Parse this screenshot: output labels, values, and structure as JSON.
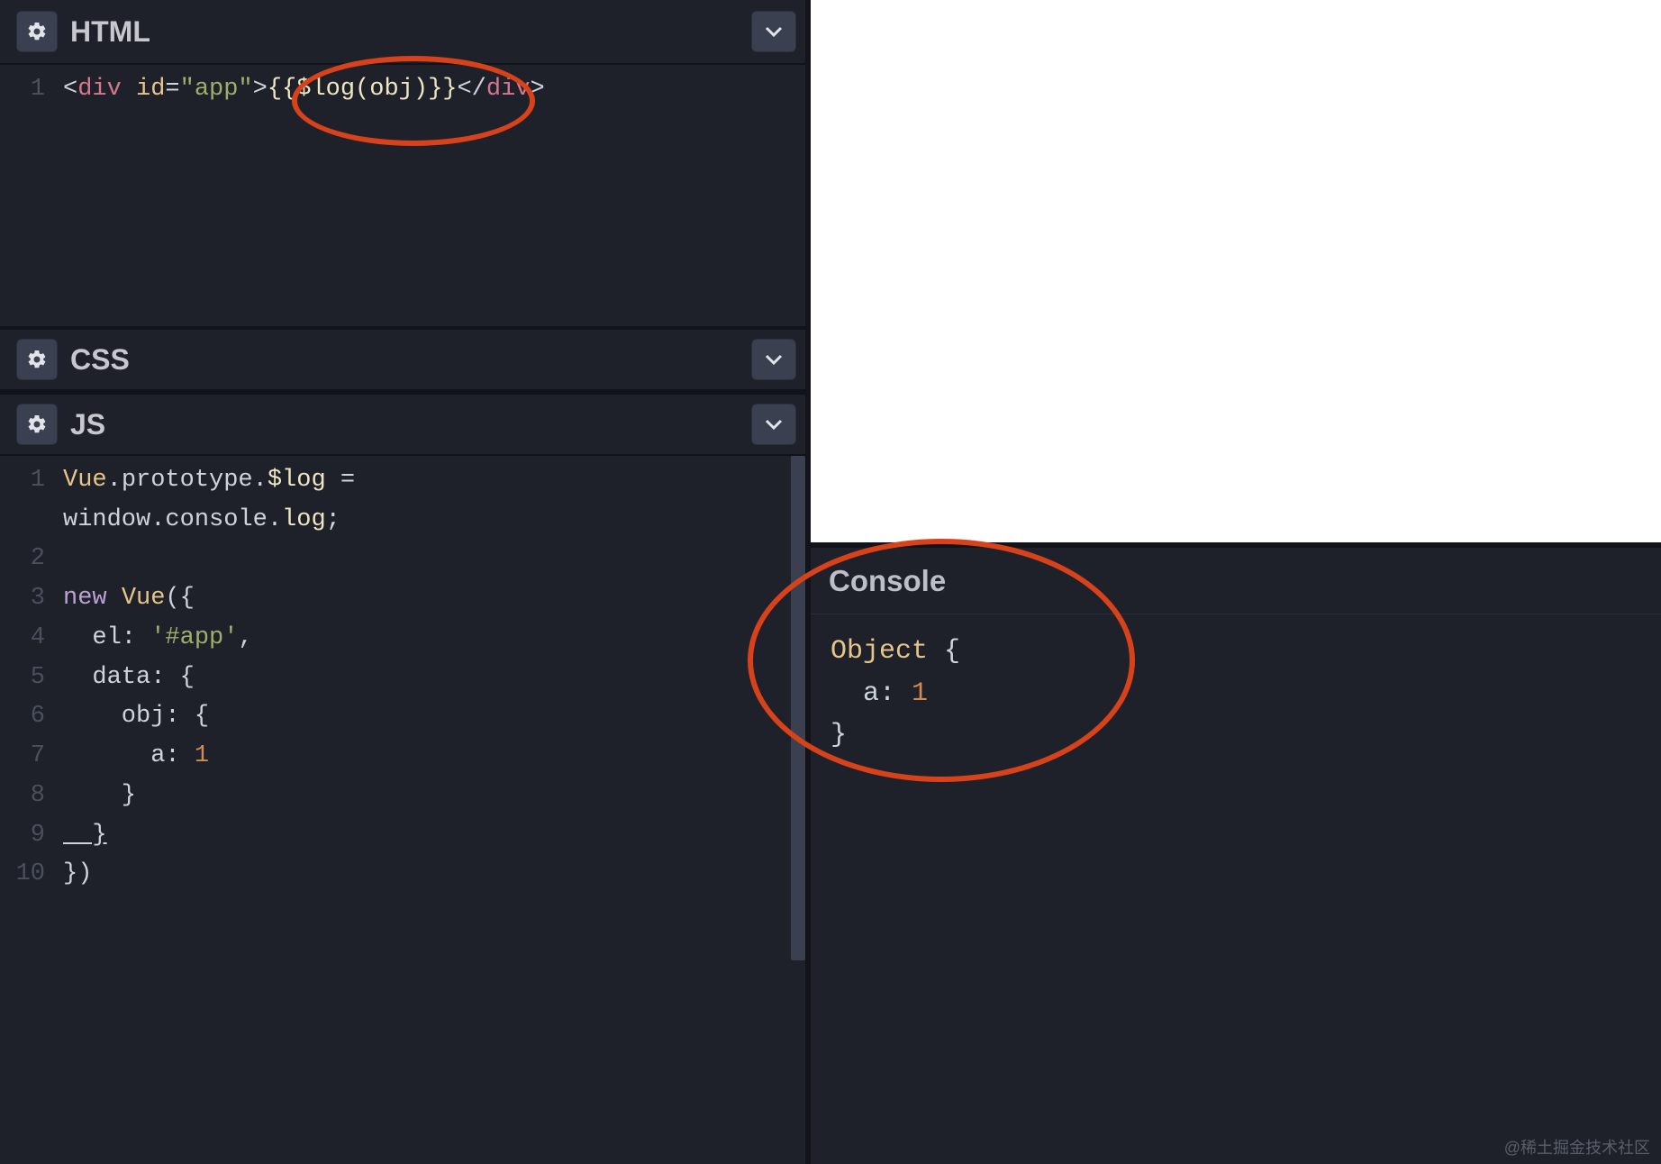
{
  "panels": {
    "html": {
      "title": "HTML"
    },
    "css": {
      "title": "CSS"
    },
    "js": {
      "title": "JS"
    }
  },
  "html_code": {
    "line1_open_punc": "<",
    "line1_tag": "div",
    "line1_attr": " id",
    "line1_eq": "=",
    "line1_str": "\"app\"",
    "line1_close": ">",
    "line1_expr": "{{$log(obj)}}",
    "line1_end_open": "</",
    "line1_end_tag": "div",
    "line1_end_close": ">"
  },
  "js_code": {
    "l1_a": "Vue",
    "l1_b": ".",
    "l1_c": "prototype",
    "l1_d": ".",
    "l1_e": "$log",
    "l1_f": " = ",
    "l1b_a": "window",
    "l1b_b": ".",
    "l1b_c": "console",
    "l1b_d": ".",
    "l1b_e": "log",
    "l1b_f": ";",
    "l3_kw": "new",
    "l3_sp": " ",
    "l3_class": "Vue",
    "l3_open": "({",
    "l4": "  el: ",
    "l4_str": "'#app'",
    "l4_comma": ",",
    "l5": "  data: {",
    "l6": "    obj: {",
    "l7": "      a: ",
    "l7_num": "1",
    "l8": "    }",
    "l9": "  }",
    "l10": "})"
  },
  "gutter": {
    "n1": "1",
    "n2": "2",
    "n3": "3",
    "n4": "4",
    "n5": "5",
    "n6": "6",
    "n7": "7",
    "n8": "8",
    "n9": "9",
    "n10": "10"
  },
  "console": {
    "title": "Console",
    "out_obj": "Object",
    "out_sp": " ",
    "out_open": "{",
    "out_line2a": "  a",
    "out_line2b": ": ",
    "out_line2c": "1",
    "out_close": "}"
  },
  "watermark": "@稀土掘金技术社区"
}
